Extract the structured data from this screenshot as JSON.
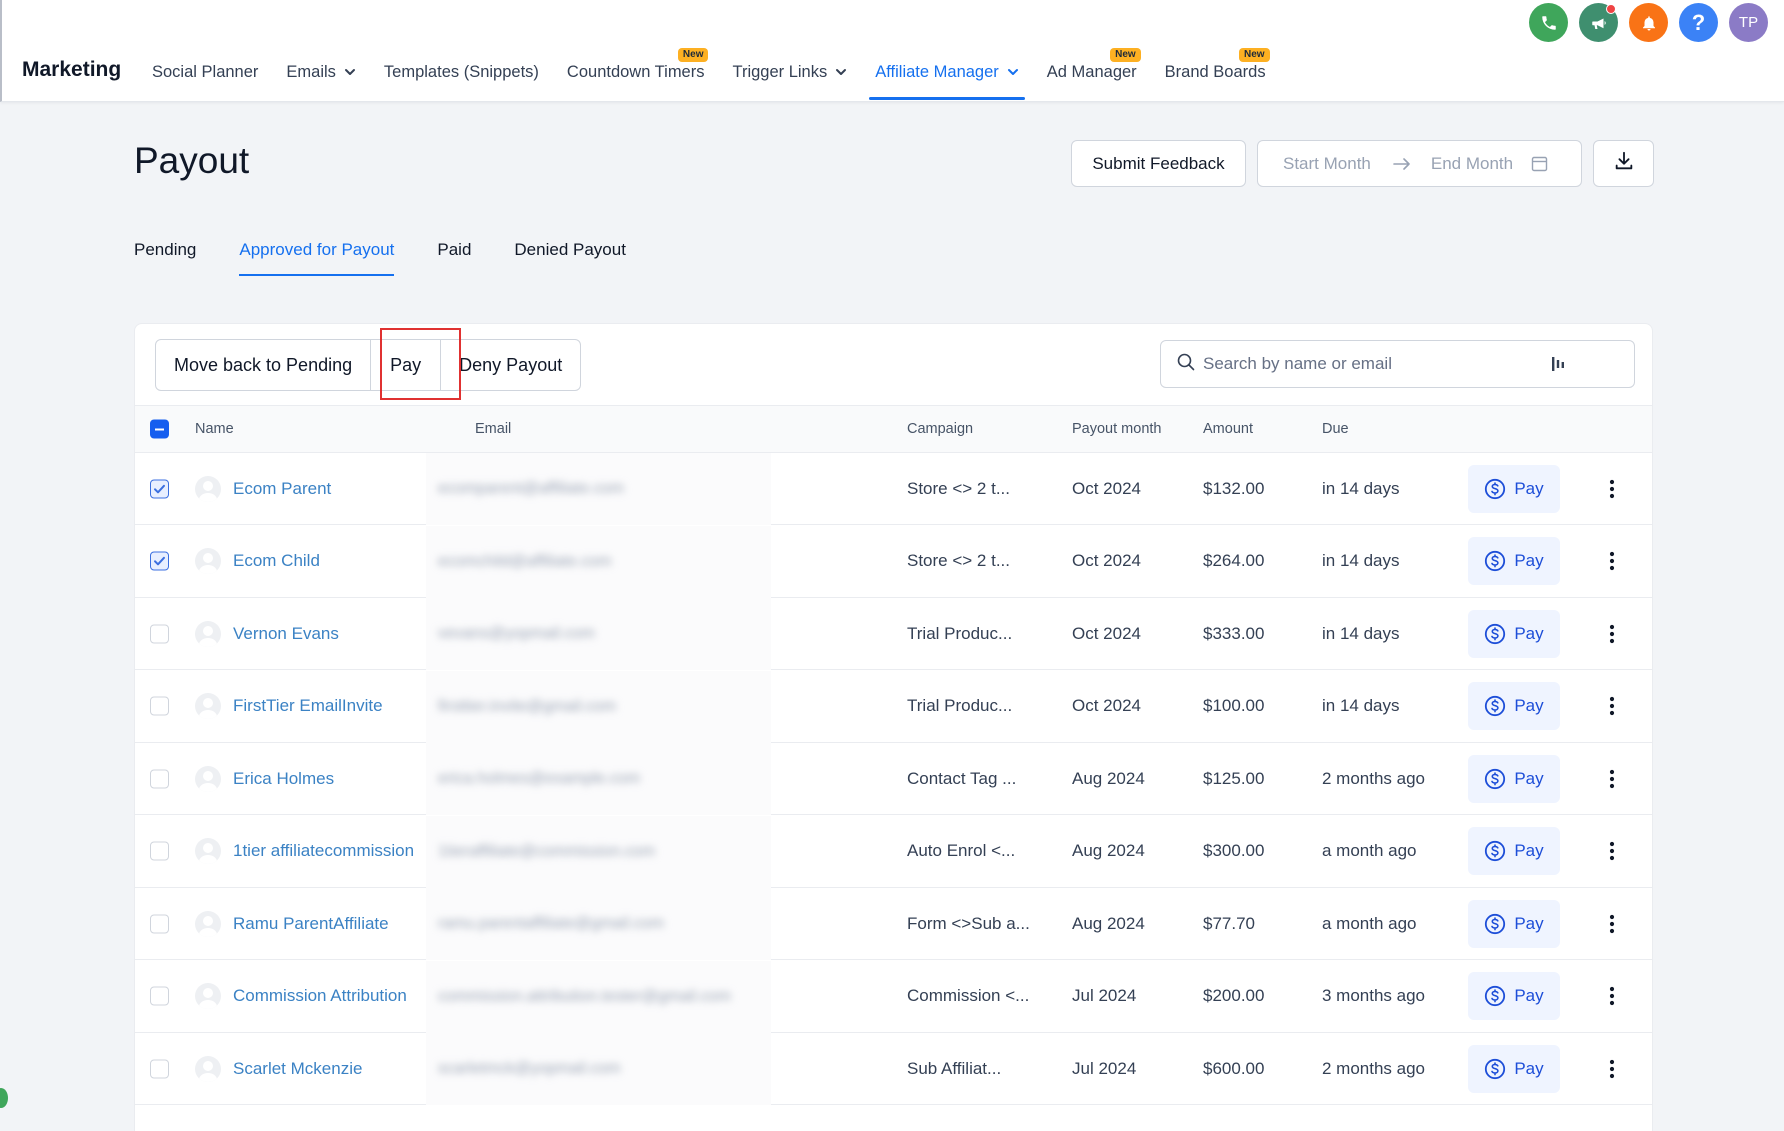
{
  "header": {
    "brand": "Marketing",
    "nav": [
      {
        "label": "Social Planner",
        "has_chevron": false,
        "badge": "",
        "active": false
      },
      {
        "label": "Emails",
        "has_chevron": true,
        "badge": "",
        "active": false
      },
      {
        "label": "Templates (Snippets)",
        "has_chevron": false,
        "badge": "",
        "active": false
      },
      {
        "label": "Countdown Timers",
        "has_chevron": false,
        "badge": "New",
        "active": false
      },
      {
        "label": "Trigger Links",
        "has_chevron": true,
        "badge": "",
        "active": false
      },
      {
        "label": "Affiliate Manager",
        "has_chevron": true,
        "badge": "",
        "active": true
      },
      {
        "label": "Ad Manager",
        "has_chevron": false,
        "badge": "New",
        "active": false
      },
      {
        "label": "Brand Boards",
        "has_chevron": false,
        "badge": "New",
        "active": false
      }
    ],
    "icons": [
      {
        "name": "phone-icon",
        "color": "#3fa65b"
      },
      {
        "name": "megaphone-icon",
        "color": "#3f8f6f"
      },
      {
        "name": "bell-icon",
        "color": "#f97316"
      },
      {
        "name": "help-icon",
        "color": "#3b82f6"
      },
      {
        "name": "avatar-initials",
        "color": "#8b7bc6"
      }
    ],
    "help_glyph": "?",
    "user_initials": "TP"
  },
  "page": {
    "title": "Payout",
    "submit_feedback": "Submit Feedback",
    "start_month_placeholder": "Start Month",
    "end_month_placeholder": "End Month"
  },
  "tabs": [
    {
      "label": "Pending",
      "active": false
    },
    {
      "label": "Approved for Payout",
      "active": true
    },
    {
      "label": "Paid",
      "active": false
    },
    {
      "label": "Denied Payout",
      "active": false
    }
  ],
  "bulk_actions": {
    "move_back": "Move back to Pending",
    "pay": "Pay",
    "deny": "Deny Payout"
  },
  "search": {
    "placeholder": "Search by name or email",
    "value": ""
  },
  "table": {
    "columns": {
      "name": "Name",
      "email": "Email",
      "campaign": "Campaign",
      "payout_month": "Payout month",
      "amount": "Amount",
      "due": "Due"
    },
    "row_action_label": "Pay",
    "rows": [
      {
        "checked": true,
        "name": "Ecom Parent",
        "email": "ecomparent@affiliate.com",
        "campaign": "Store <> 2 t...",
        "payout_month": "Oct 2024",
        "amount": "$132.00",
        "due": "in 14 days"
      },
      {
        "checked": true,
        "name": "Ecom Child",
        "email": "ecomchild@affiliate.com",
        "campaign": "Store <> 2 t...",
        "payout_month": "Oct 2024",
        "amount": "$264.00",
        "due": "in 14 days"
      },
      {
        "checked": false,
        "name": "Vernon Evans",
        "email": "vevans@yopmail.com",
        "campaign": "Trial Produc...",
        "payout_month": "Oct 2024",
        "amount": "$333.00",
        "due": "in 14 days"
      },
      {
        "checked": false,
        "name": "FirstTier EmailInvite",
        "email": "firsttier.invite@gmail.com",
        "campaign": "Trial Produc...",
        "payout_month": "Oct 2024",
        "amount": "$100.00",
        "due": "in 14 days"
      },
      {
        "checked": false,
        "name": "Erica Holmes",
        "email": "erica.holmes@example.com",
        "campaign": "Contact Tag ...",
        "payout_month": "Aug 2024",
        "amount": "$125.00",
        "due": "2 months ago"
      },
      {
        "checked": false,
        "name": "1tier affiliatecommission",
        "email": "1tieraffiliate@commission.com",
        "campaign": "Auto Enrol <...",
        "payout_month": "Aug 2024",
        "amount": "$300.00",
        "due": "a month ago"
      },
      {
        "checked": false,
        "name": "Ramu ParentAffiliate",
        "email": "ramu.parentaffiliate@gmail.com",
        "campaign": "Form <>Sub a...",
        "payout_month": "Aug 2024",
        "amount": "$77.70",
        "due": "a month ago"
      },
      {
        "checked": false,
        "name": "Commission Attribution",
        "email": "commission.attribution.tester@gmail.com",
        "campaign": "Commission <...",
        "payout_month": "Jul 2024",
        "amount": "$200.00",
        "due": "3 months ago"
      },
      {
        "checked": false,
        "name": "Scarlet Mckenzie",
        "email": "scarletmck@yopmail.com",
        "campaign": "Sub Affiliat...",
        "payout_month": "Jul 2024",
        "amount": "$600.00",
        "due": "2 months ago"
      }
    ]
  },
  "colors": {
    "accent": "#1570ef",
    "link": "#3b82c4",
    "badge": "#fdb022",
    "highlight_box": "#e03131"
  }
}
